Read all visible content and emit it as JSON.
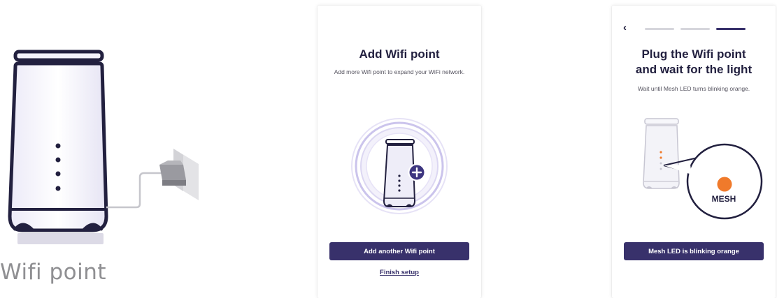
{
  "illustration": {
    "label": "Wifi point"
  },
  "screen1": {
    "title": "Add Wifi point",
    "subtitle": "Add more Wifi point to expand your WiFi network.",
    "primary_button": "Add another Wifi point",
    "link": "Finish setup",
    "icons": [
      "wifi-point-icon",
      "plus-icon"
    ]
  },
  "screen2": {
    "back_icon": "chevron-left-icon",
    "steps": {
      "total": 3,
      "current": 3
    },
    "title_line1": "Plug the Wifi point",
    "title_line2": "and wait for the light",
    "subtitle": "Wait until Mesh LED turns blinking orange.",
    "callout_label": "MESH",
    "primary_button": "Mesh LED is blinking orange"
  },
  "colors": {
    "brand": "#38316b",
    "text_dark": "#22203f",
    "led_orange": "#f07a2b",
    "ring": "#c9c3e8",
    "device_fill": "#eeedf8",
    "grey": "#8f8f92"
  }
}
